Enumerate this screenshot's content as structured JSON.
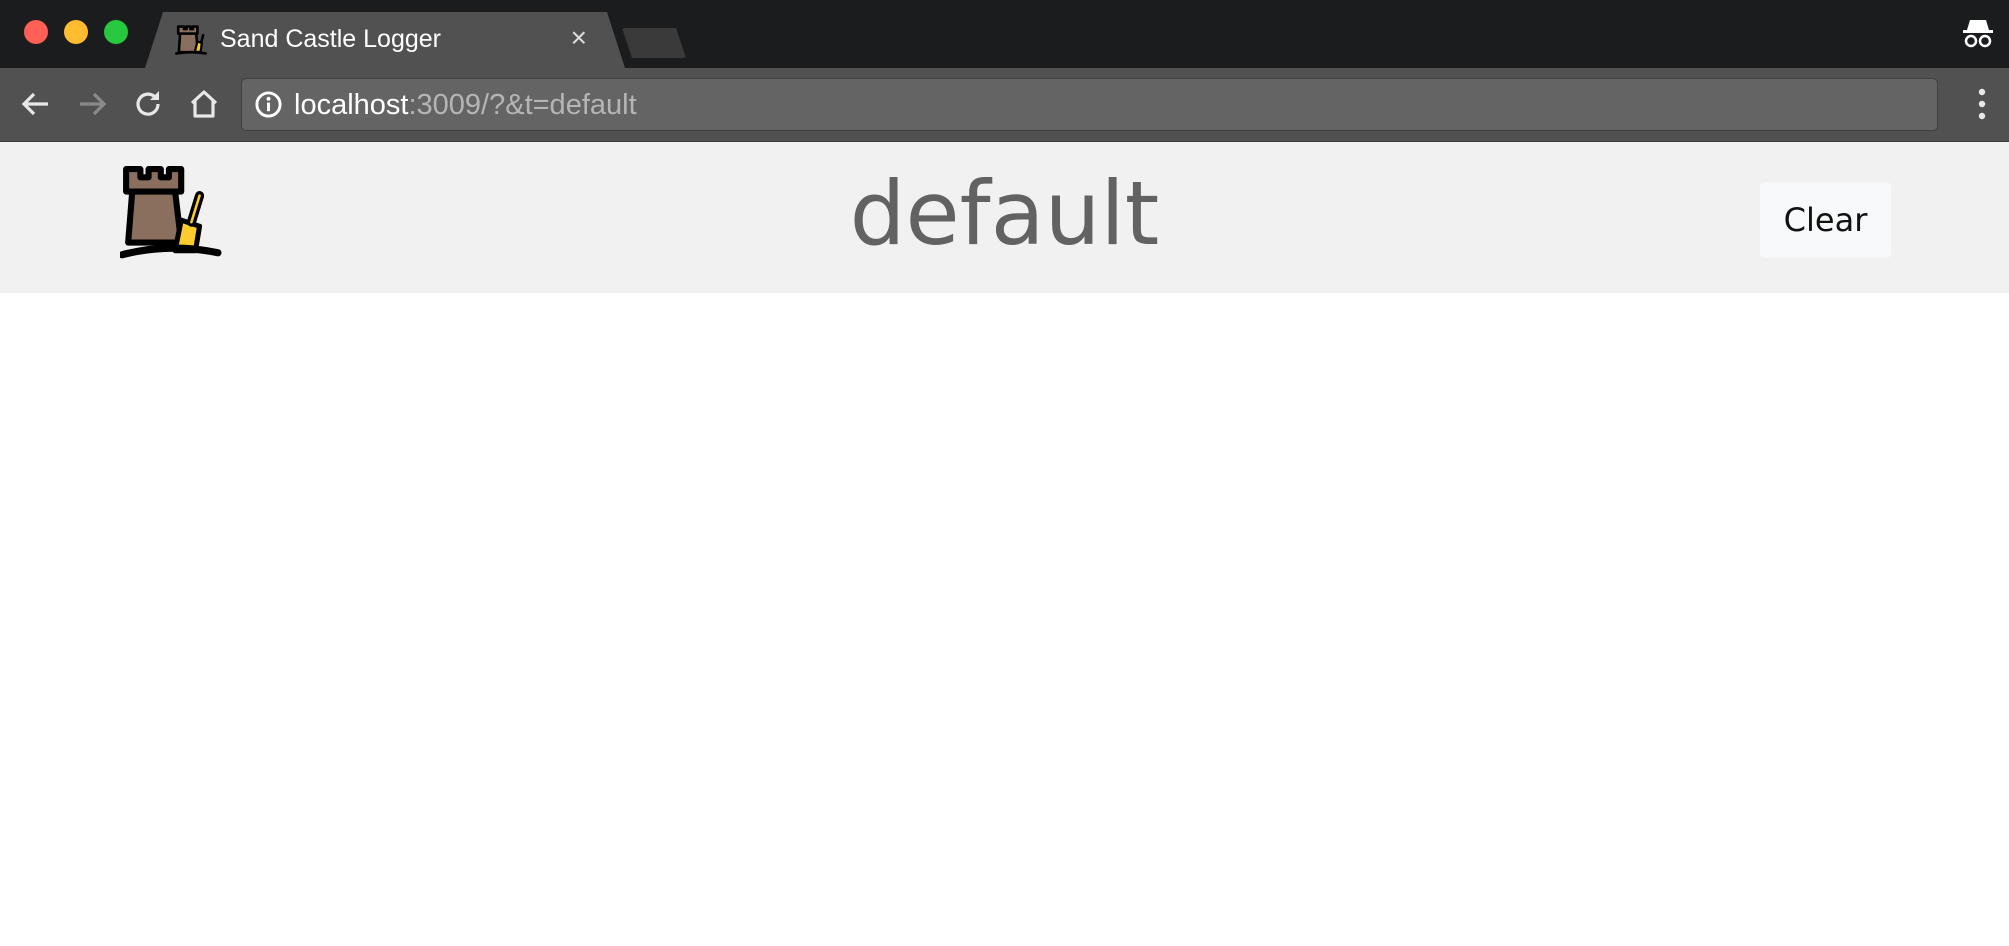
{
  "browser": {
    "tab_title": "Sand Castle Logger",
    "tab_close": "×",
    "url_host": "localhost",
    "url_rest": ":3009/?&t=default"
  },
  "header": {
    "title": "default",
    "clear_label": "Clear"
  },
  "colors": {
    "close_light": "#fe5f57",
    "minimize_light": "#febc2e",
    "maximize_light": "#28c840",
    "header_bg": "#f1f1f1",
    "castle": "#8b6f5e",
    "shovel": "#fdcb2e"
  }
}
